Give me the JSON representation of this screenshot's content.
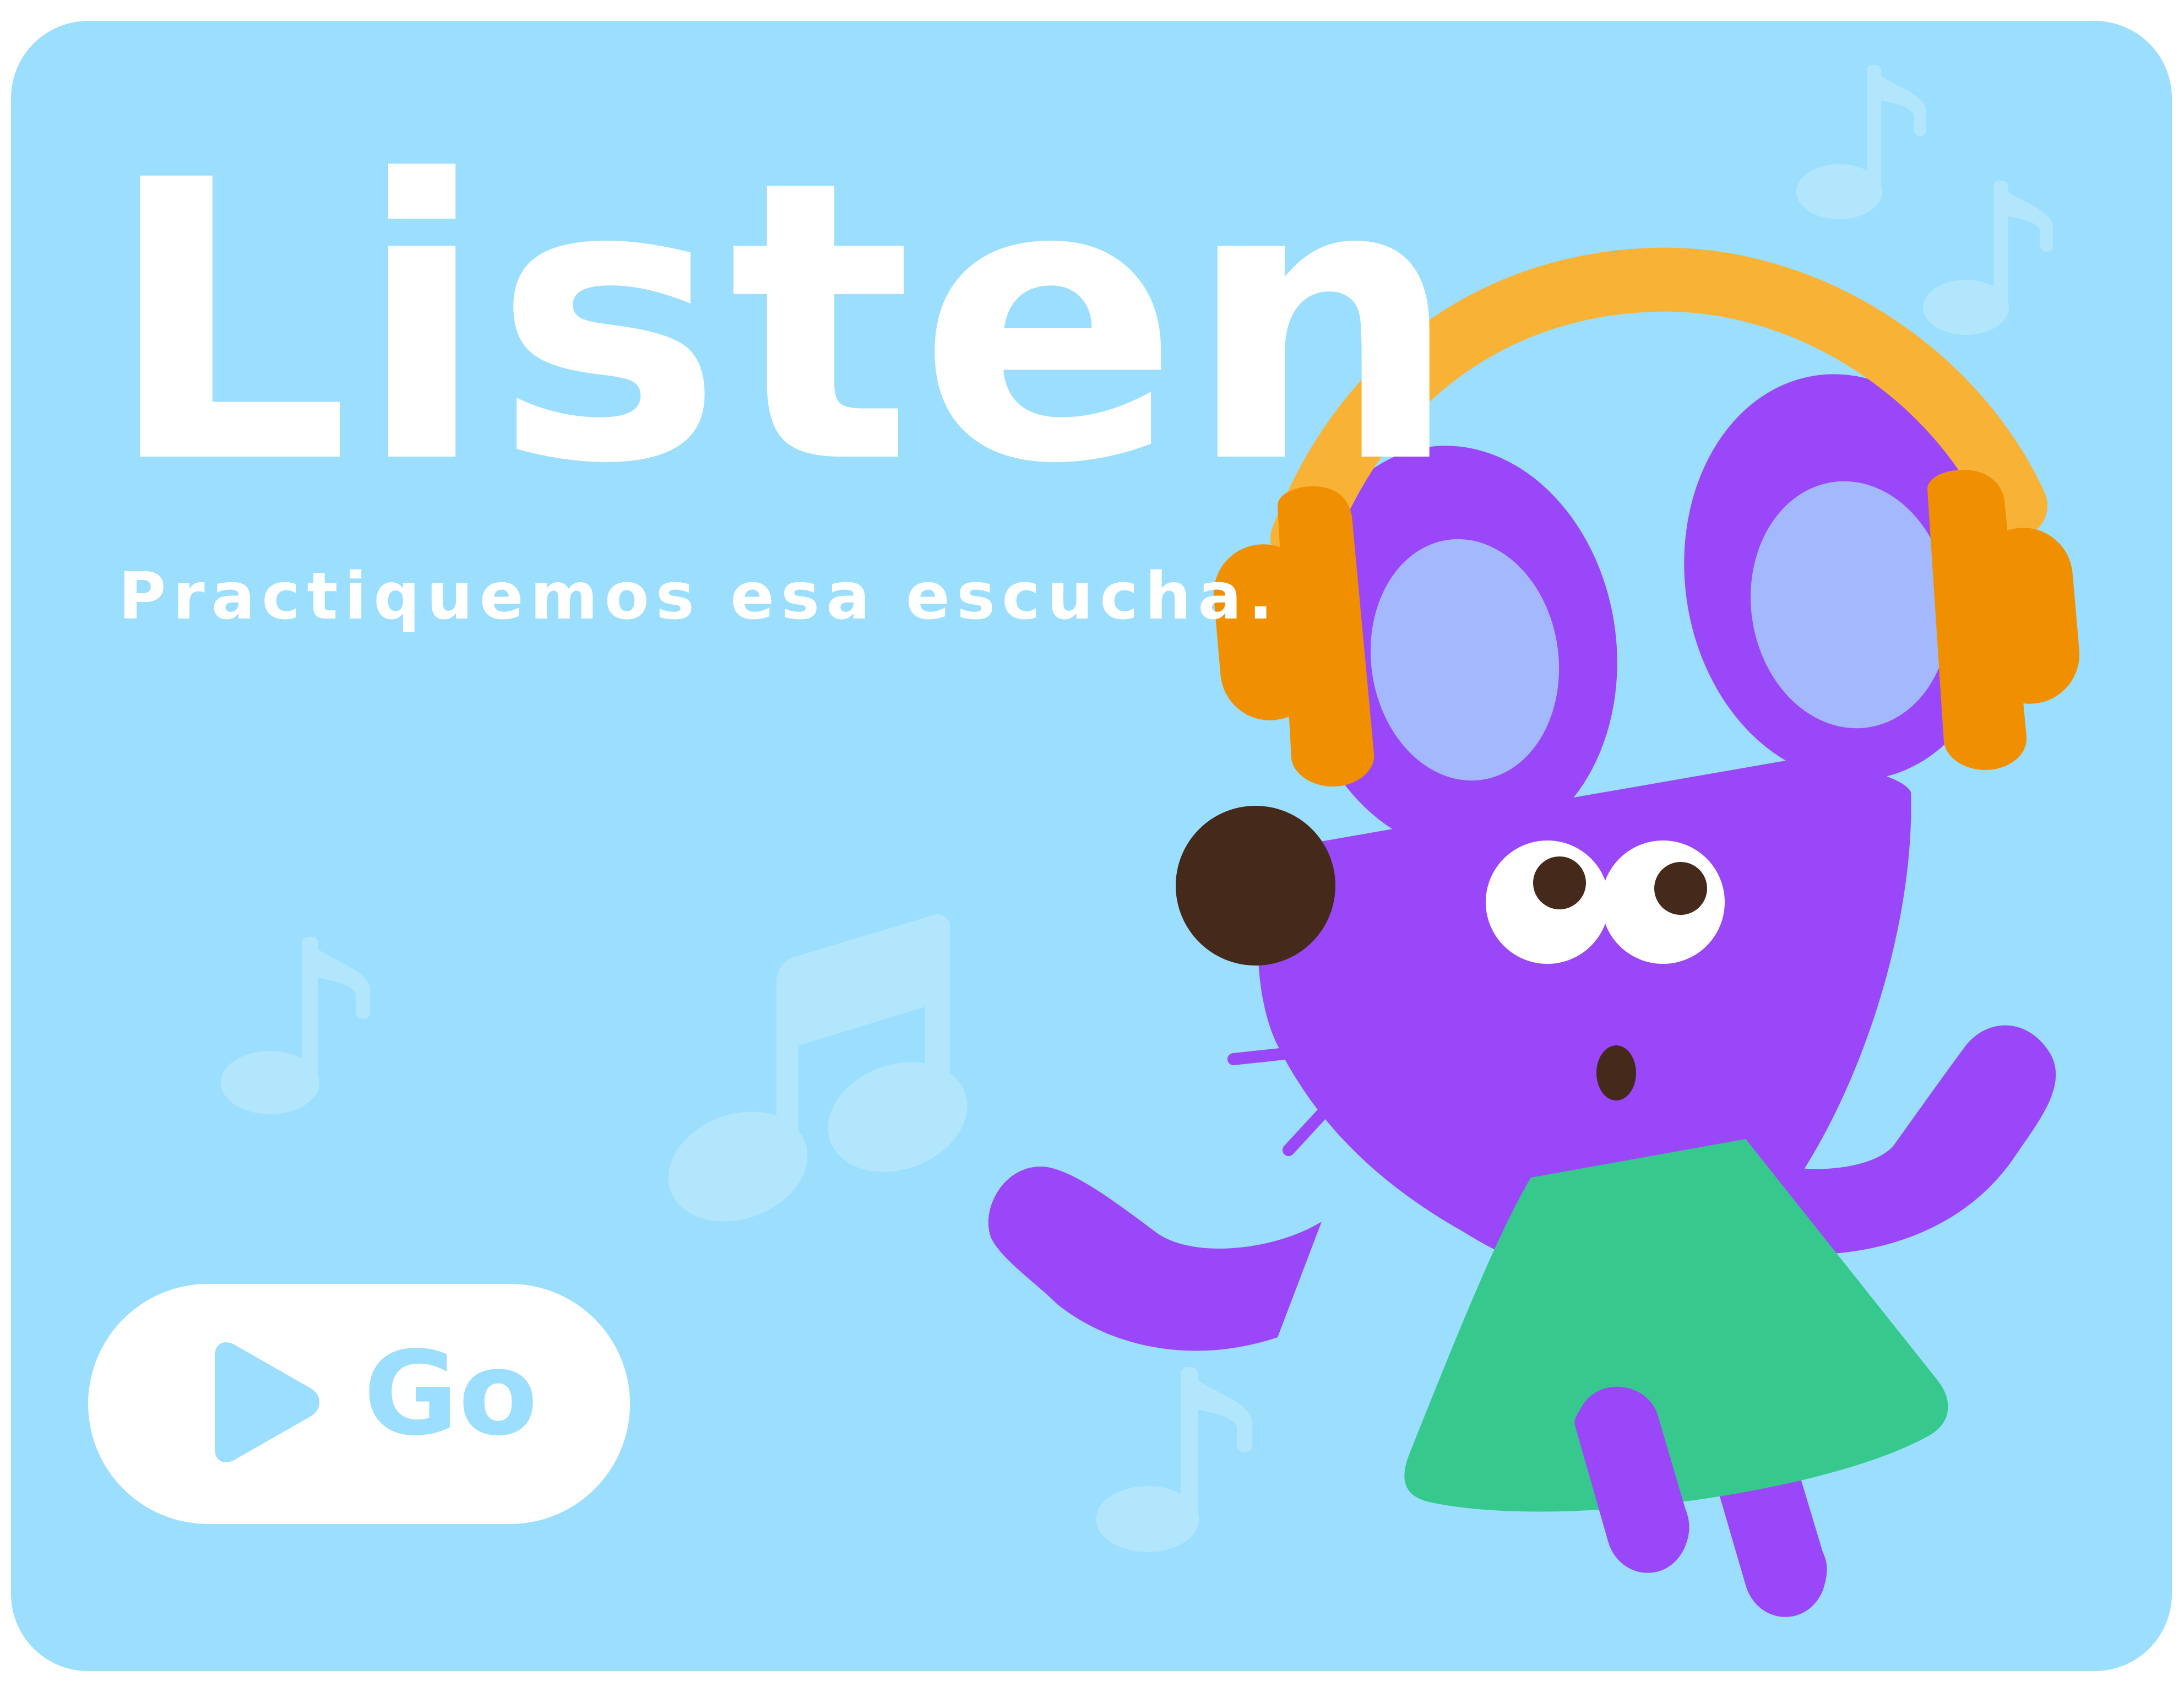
{
  "card": {
    "title": "Listen",
    "subtitle": "Practiquemos esa escucha."
  },
  "go_button": {
    "label": "Go",
    "icon": "play-icon"
  },
  "illustration": {
    "character": "mouse-with-headphones",
    "decorations": [
      "music-note-icon",
      "double-music-note-icon"
    ]
  },
  "colors": {
    "background": "#9bdefd",
    "text": "#ffffff",
    "mouse": "#9a47fa",
    "inner_ear": "#a4b8fd",
    "headphone_band": "#f8b336",
    "headphone_cup": "#f09000",
    "dress": "#37c88e",
    "nose": "#45291a",
    "note": "#b2e6fc"
  }
}
